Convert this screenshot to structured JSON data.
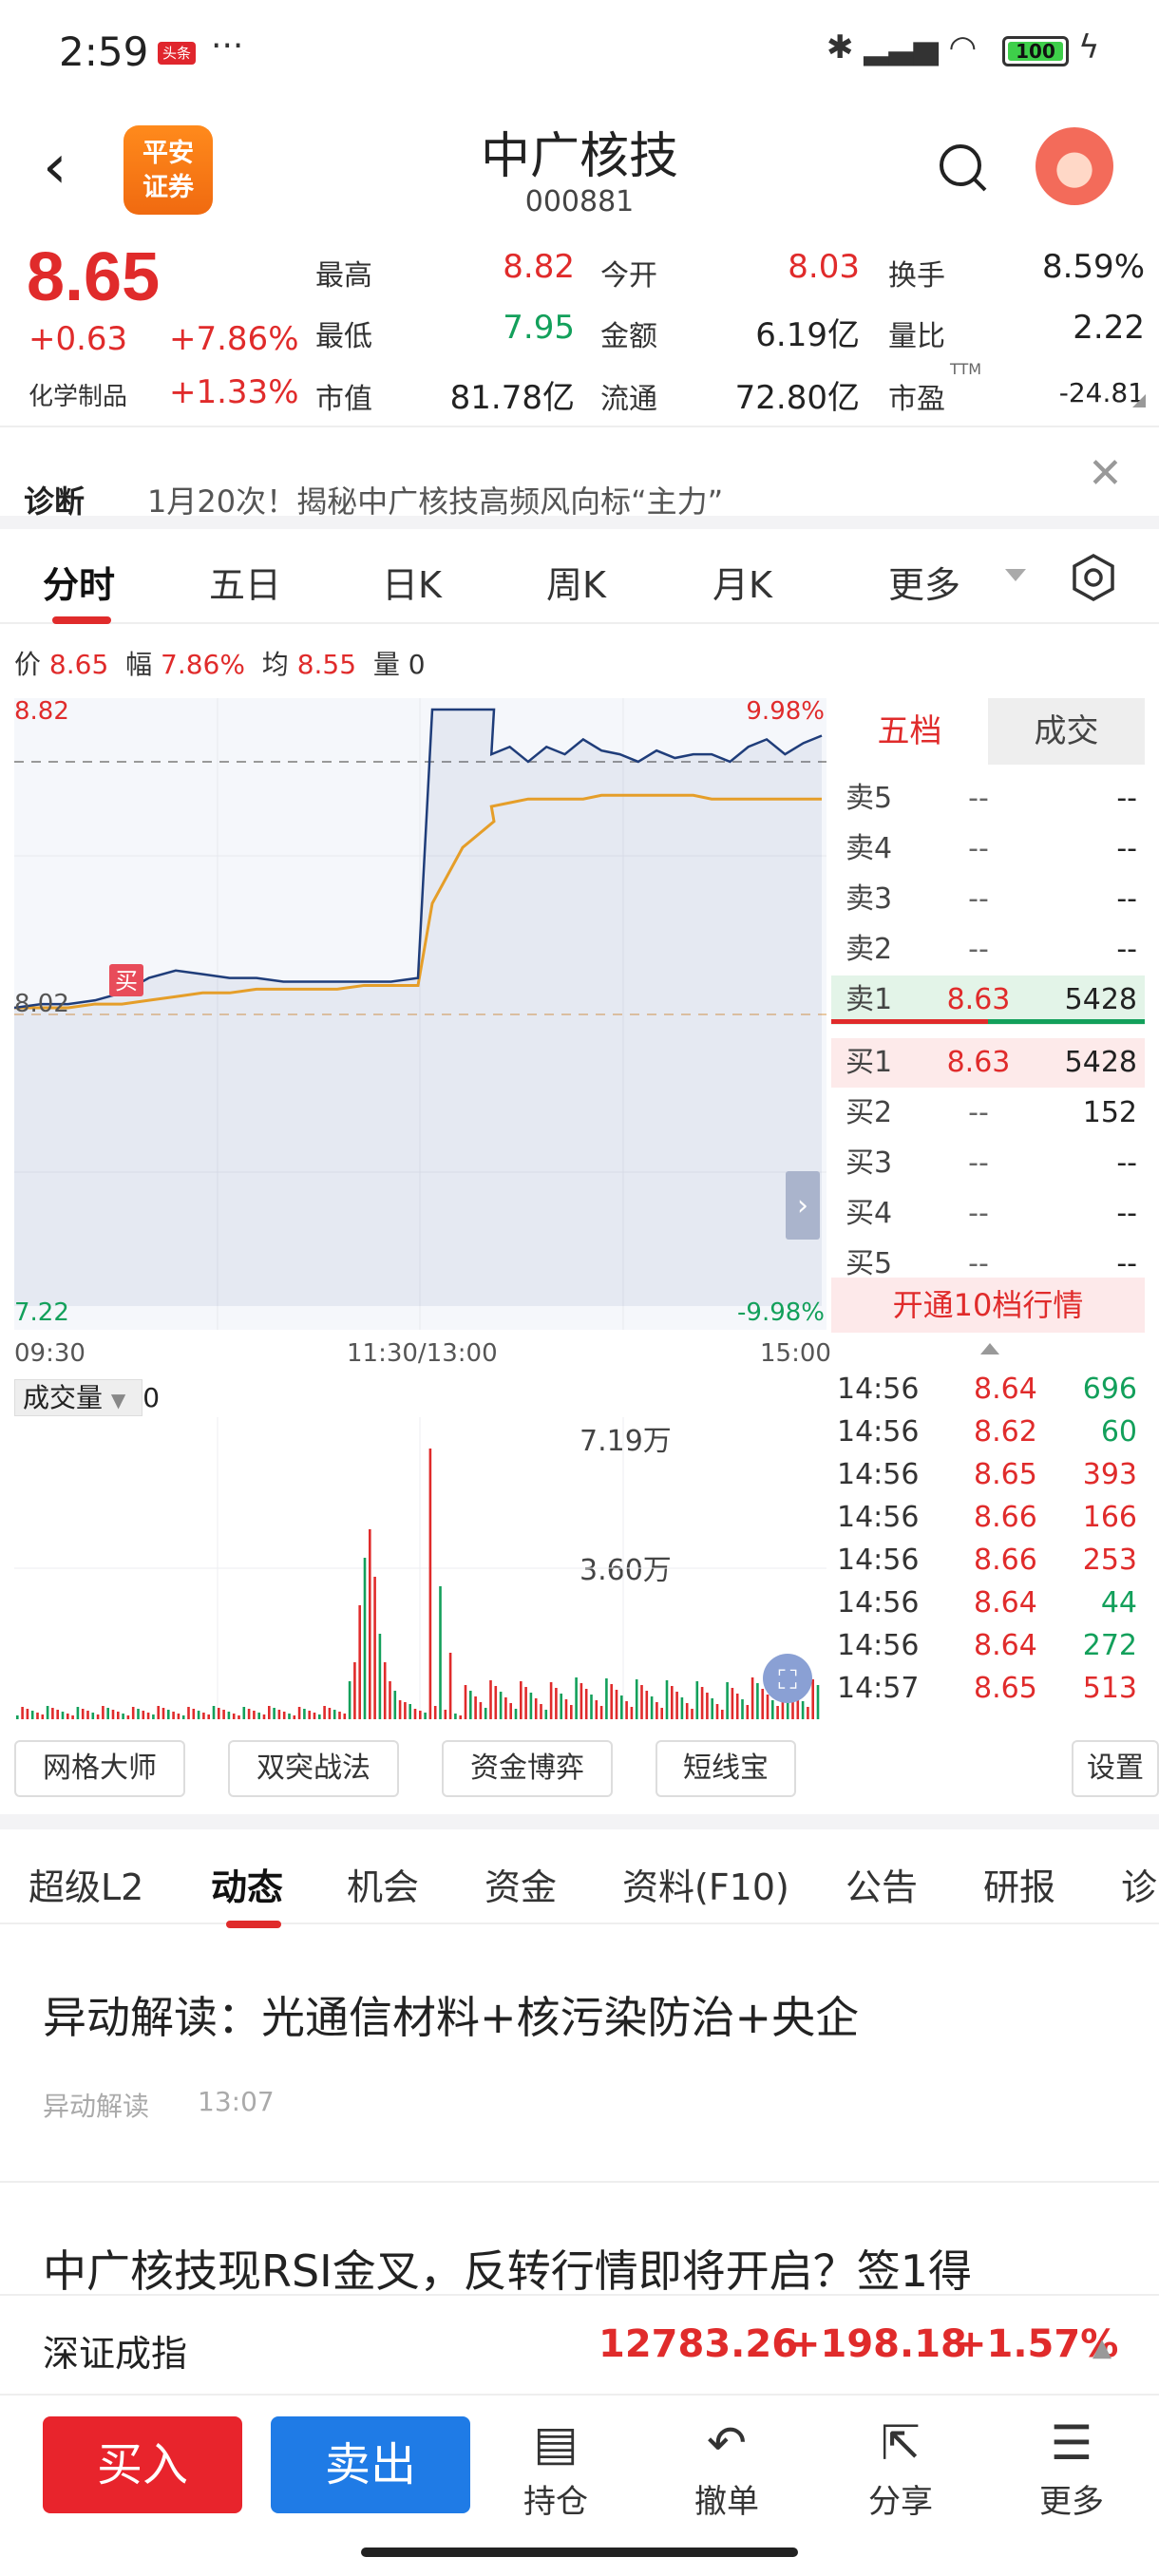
{
  "status_bar": {
    "time": "2:59",
    "badge": "头条",
    "dots": "···",
    "battery": "100"
  },
  "header": {
    "back": "‹",
    "logo_line1": "平安",
    "logo_line2": "证券",
    "name": "中广核技",
    "code": "000881"
  },
  "quote": {
    "price": "8.65",
    "change": "+0.63",
    "change_pct": "+7.86%",
    "industry": "化学制品",
    "industry_change": "+1.33%",
    "fields": [
      {
        "label": "最高",
        "value": "8.82",
        "color": "red"
      },
      {
        "label": "今开",
        "value": "8.03",
        "color": "red"
      },
      {
        "label": "换手",
        "value": "8.59%",
        "color": "black"
      },
      {
        "label": "最低",
        "value": "7.95",
        "color": "green"
      },
      {
        "label": "金额",
        "value": "6.19亿",
        "color": "black"
      },
      {
        "label": "量比",
        "value": "2.22",
        "color": "black"
      },
      {
        "label": "市值",
        "value": "81.78亿",
        "color": "black"
      },
      {
        "label": "流通",
        "value": "72.80亿",
        "color": "black"
      },
      {
        "label": "市盈",
        "value": "-24.81",
        "color": "black",
        "sup": "TTM"
      }
    ]
  },
  "diagnosis": {
    "label": "诊断",
    "text": "1月20次！揭秘中广核技高频风向标“主力”"
  },
  "chart_tabs": [
    "分时",
    "五日",
    "日K",
    "周K",
    "月K",
    "更多"
  ],
  "info_line": {
    "price_label": "价",
    "price": "8.65",
    "amp_label": "幅",
    "amp": "7.86%",
    "avg_label": "均",
    "avg": "8.55",
    "vol_label": "量",
    "vol": "0"
  },
  "chart_labels": {
    "top_left": "8.82",
    "top_right": "9.98%",
    "mid_left": "8.02",
    "bottom_left": "7.22",
    "bottom_right": "-9.98%",
    "buy_mark": "买"
  },
  "time_axis": [
    "09:30",
    "11:30/13:00",
    "15:00"
  ],
  "orderbook": {
    "tabs": [
      "五档",
      "成交"
    ],
    "sell": [
      {
        "name": "卖5",
        "price": "--",
        "vol": "--"
      },
      {
        "name": "卖4",
        "price": "--",
        "vol": "--"
      },
      {
        "name": "卖3",
        "price": "--",
        "vol": "--"
      },
      {
        "name": "卖2",
        "price": "--",
        "vol": "--"
      },
      {
        "name": "卖1",
        "price": "8.63",
        "vol": "5428"
      }
    ],
    "buy": [
      {
        "name": "买1",
        "price": "8.63",
        "vol": "5428"
      },
      {
        "name": "买2",
        "price": "--",
        "vol": "152"
      },
      {
        "name": "买3",
        "price": "--",
        "vol": "--"
      },
      {
        "name": "买4",
        "price": "--",
        "vol": "--"
      },
      {
        "name": "买5",
        "price": "--",
        "vol": "--"
      }
    ],
    "open10": "开通10档行情"
  },
  "volume": {
    "label": "成交量",
    "value": "0",
    "max_label": "7.19万",
    "mid_label": "3.60万"
  },
  "trades": [
    {
      "time": "14:56",
      "price": "8.64",
      "vol": "696",
      "vc": "green"
    },
    {
      "time": "14:56",
      "price": "8.62",
      "vol": "60",
      "vc": "green"
    },
    {
      "time": "14:56",
      "price": "8.65",
      "vol": "393",
      "vc": "red"
    },
    {
      "time": "14:56",
      "price": "8.66",
      "vol": "166",
      "vc": "red"
    },
    {
      "time": "14:56",
      "price": "8.66",
      "vol": "253",
      "vc": "red"
    },
    {
      "time": "14:56",
      "price": "8.64",
      "vol": "44",
      "vc": "green"
    },
    {
      "time": "14:56",
      "price": "8.64",
      "vol": "272",
      "vc": "green"
    },
    {
      "time": "14:57",
      "price": "8.65",
      "vol": "513",
      "vc": "red"
    }
  ],
  "tools": [
    "网格大师",
    "双突战法",
    "资金博弈",
    "短线宝",
    "设置"
  ],
  "news_tabs": [
    "超级L2",
    "动态",
    "机会",
    "资金",
    "资料(F10)",
    "公告",
    "研报",
    "诊"
  ],
  "news": [
    {
      "title": "异动解读：光通信材料+核污染防治+央企",
      "source": "异动解读",
      "time": "13:07"
    },
    {
      "title": "中广核技现RSI金叉，反转行情即将开启？签1得"
    }
  ],
  "index": {
    "name": "深证成指",
    "value": "12783.26",
    "change": "+198.18",
    "pct": "+1.57%"
  },
  "bottom": {
    "buy": "买入",
    "sell": "卖出",
    "actions": [
      "持仓",
      "撤单",
      "分享",
      "更多"
    ]
  },
  "colors": {
    "red": "#e02b2b",
    "green": "#13a05b",
    "blue_line": "#1f3d7a",
    "avg_line": "#f5a623",
    "buy_btn": "#e8242c",
    "sell_btn": "#1f7be6"
  },
  "chart_data": {
    "type": "line",
    "series": [
      {
        "values": [
          8.02,
          8.03,
          8.03,
          8.04,
          8.06,
          8.1,
          8.12,
          8.11,
          8.1,
          8.1,
          8.09,
          8.09,
          8.09,
          8.09,
          8.09,
          8.1,
          8.82,
          8.82,
          8.82,
          8.7,
          8.72,
          8.68,
          8.72,
          8.7,
          8.74,
          8.71,
          8.7,
          8.68,
          8.71,
          8.69,
          8.7,
          8.7,
          8.68,
          8.72,
          8.74,
          8.7,
          8.73,
          8.75
        ]
      },
      {
        "values": [
          8.02,
          8.02,
          8.02,
          8.03,
          8.03,
          8.04,
          8.05,
          8.06,
          8.06,
          8.07,
          8.07,
          8.07,
          8.07,
          8.08,
          8.08,
          8.08,
          8.3,
          8.45,
          8.52,
          8.56,
          8.57,
          8.58,
          8.58,
          8.58,
          8.58,
          8.59,
          8.59,
          8.59,
          8.59,
          8.59,
          8.59,
          8.58,
          8.58,
          8.58,
          8.58,
          8.58,
          8.58,
          8.58
        ]
      }
    ],
    "ylim": [
      7.22,
      8.82
    ],
    "volume_ylim": [
      0,
      7.19
    ]
  }
}
